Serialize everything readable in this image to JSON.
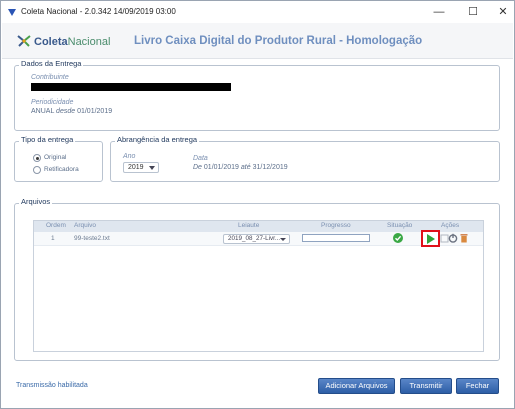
{
  "window": {
    "title": "Coleta Nacional - 2.0.342   14/09/2019 03:00",
    "minimize_glyph": "—",
    "maximize_glyph": "☐",
    "close_glyph": "✕"
  },
  "header": {
    "logo_bold": "Coleta",
    "logo_thin": "Nacional",
    "title": "Livro Caixa Digital do Produtor Rural - Homologação"
  },
  "dados": {
    "legend": "Dados da Entrega",
    "contribuinte_label": "Contribuinte",
    "periodicidade_label": "Periodicidade",
    "periodicidade_value": "ANUAL",
    "desde_word": "desde",
    "desde_date": "01/01/2019"
  },
  "tipo": {
    "legend": "Tipo da entrega",
    "options": [
      "Original",
      "Retificadora"
    ],
    "selected": "Original"
  },
  "abrangencia": {
    "legend": "Abrangência da entrega",
    "ano_label": "Ano",
    "ano_value": "2019",
    "data_label": "Data",
    "de_word": "De",
    "data_inicio": "01/01/2019",
    "ate_word": "até",
    "data_fim": "31/12/2019"
  },
  "arquivos": {
    "legend": "Arquivos",
    "columns": {
      "ordem": "Ordem",
      "arquivo": "Arquivo",
      "leiaute": "Leiaute",
      "progresso": "Progresso",
      "situacao": "Situação",
      "acoes": "Ações"
    },
    "rows": [
      {
        "ordem": "1",
        "arquivo": "99-teste2.txt",
        "leiaute": "2019_08_27-Livr...",
        "progresso": 0
      }
    ]
  },
  "footer": {
    "status": "Transmissão habilitada",
    "add_label": "Adicionar Arquivos",
    "transmit_label": "Transmitir",
    "close_label": "Fechar"
  },
  "colors": {
    "accent": "#2d5ea6",
    "highlight_box": "#e0101a",
    "ok_green": "#3aa845"
  }
}
